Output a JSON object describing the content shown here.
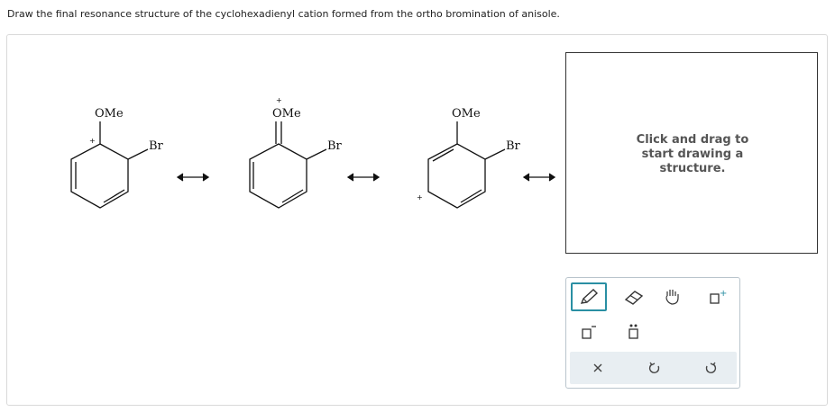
{
  "question": "Draw the final resonance structure of the cyclohexadienyl cation formed from the ortho bromination of anisole.",
  "structures": [
    {
      "ome": "OMe",
      "br": "Br",
      "charge": "+"
    },
    {
      "ome": "OMe",
      "br": "Br",
      "charge": "+"
    },
    {
      "ome": "OMe",
      "br": "Br",
      "charge": "+"
    }
  ],
  "canvas": {
    "hint_line1": "Click and drag to",
    "hint_line2": "start drawing a",
    "hint_line3": "structure."
  },
  "toolbar": {
    "tools": [
      "pencil-icon",
      "eraser-icon",
      "hand-icon",
      "add-charge-icon",
      "negative-charge-icon",
      "lone-pair-icon"
    ],
    "actions": [
      "clear-icon",
      "undo-icon",
      "redo-icon"
    ],
    "active_tool": "pencil-icon",
    "accent_color": "#2a8fa3"
  }
}
